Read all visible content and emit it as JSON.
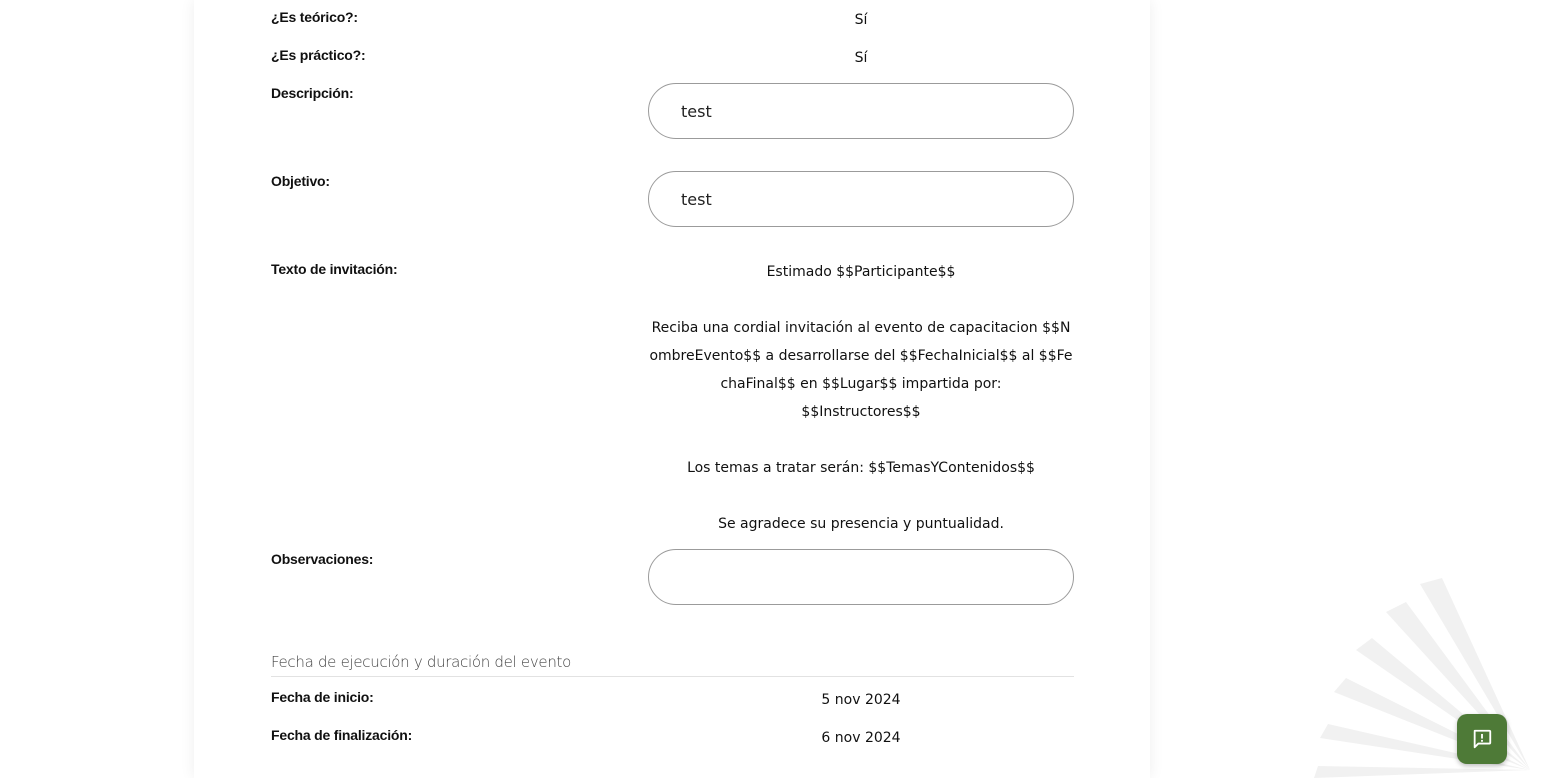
{
  "fields": {
    "teorico": {
      "label": "¿Es teórico?:",
      "value": "Sí"
    },
    "practico": {
      "label": "¿Es práctico?:",
      "value": "Sí"
    },
    "descripcion": {
      "label": "Descripción:",
      "value": "test"
    },
    "objetivo": {
      "label": "Objetivo:",
      "value": "test"
    },
    "invitacion": {
      "label": "Texto de invitación:",
      "paragraphs": [
        "Estimado $$Participante$$",
        "Reciba una cordial invitación al evento de capacitacion $$NombreEvento$$ a desarrollarse del $$FechaInicial$$ al $$FechaFinal$$ en $$Lugar$$ impartida por:",
        "$$Instructores$$",
        "Los temas a tratar serán: $$TemasYContenidos$$",
        "Se agradece su presencia y puntualidad."
      ]
    },
    "observaciones": {
      "label": "Observaciones:",
      "value": ""
    }
  },
  "schedule": {
    "title": "Fecha de ejecución y duración del evento",
    "inicio": {
      "label": "Fecha de inicio:",
      "value": "5 nov 2024"
    },
    "fin": {
      "label": "Fecha de finalización:",
      "value": "6 nov 2024"
    }
  },
  "colors": {
    "feedback_button": "#4e7a37",
    "field_border": "#9b9b9b"
  },
  "icons": {
    "feedback": "feedback-icon",
    "decoration": "sunburst-decoration"
  }
}
